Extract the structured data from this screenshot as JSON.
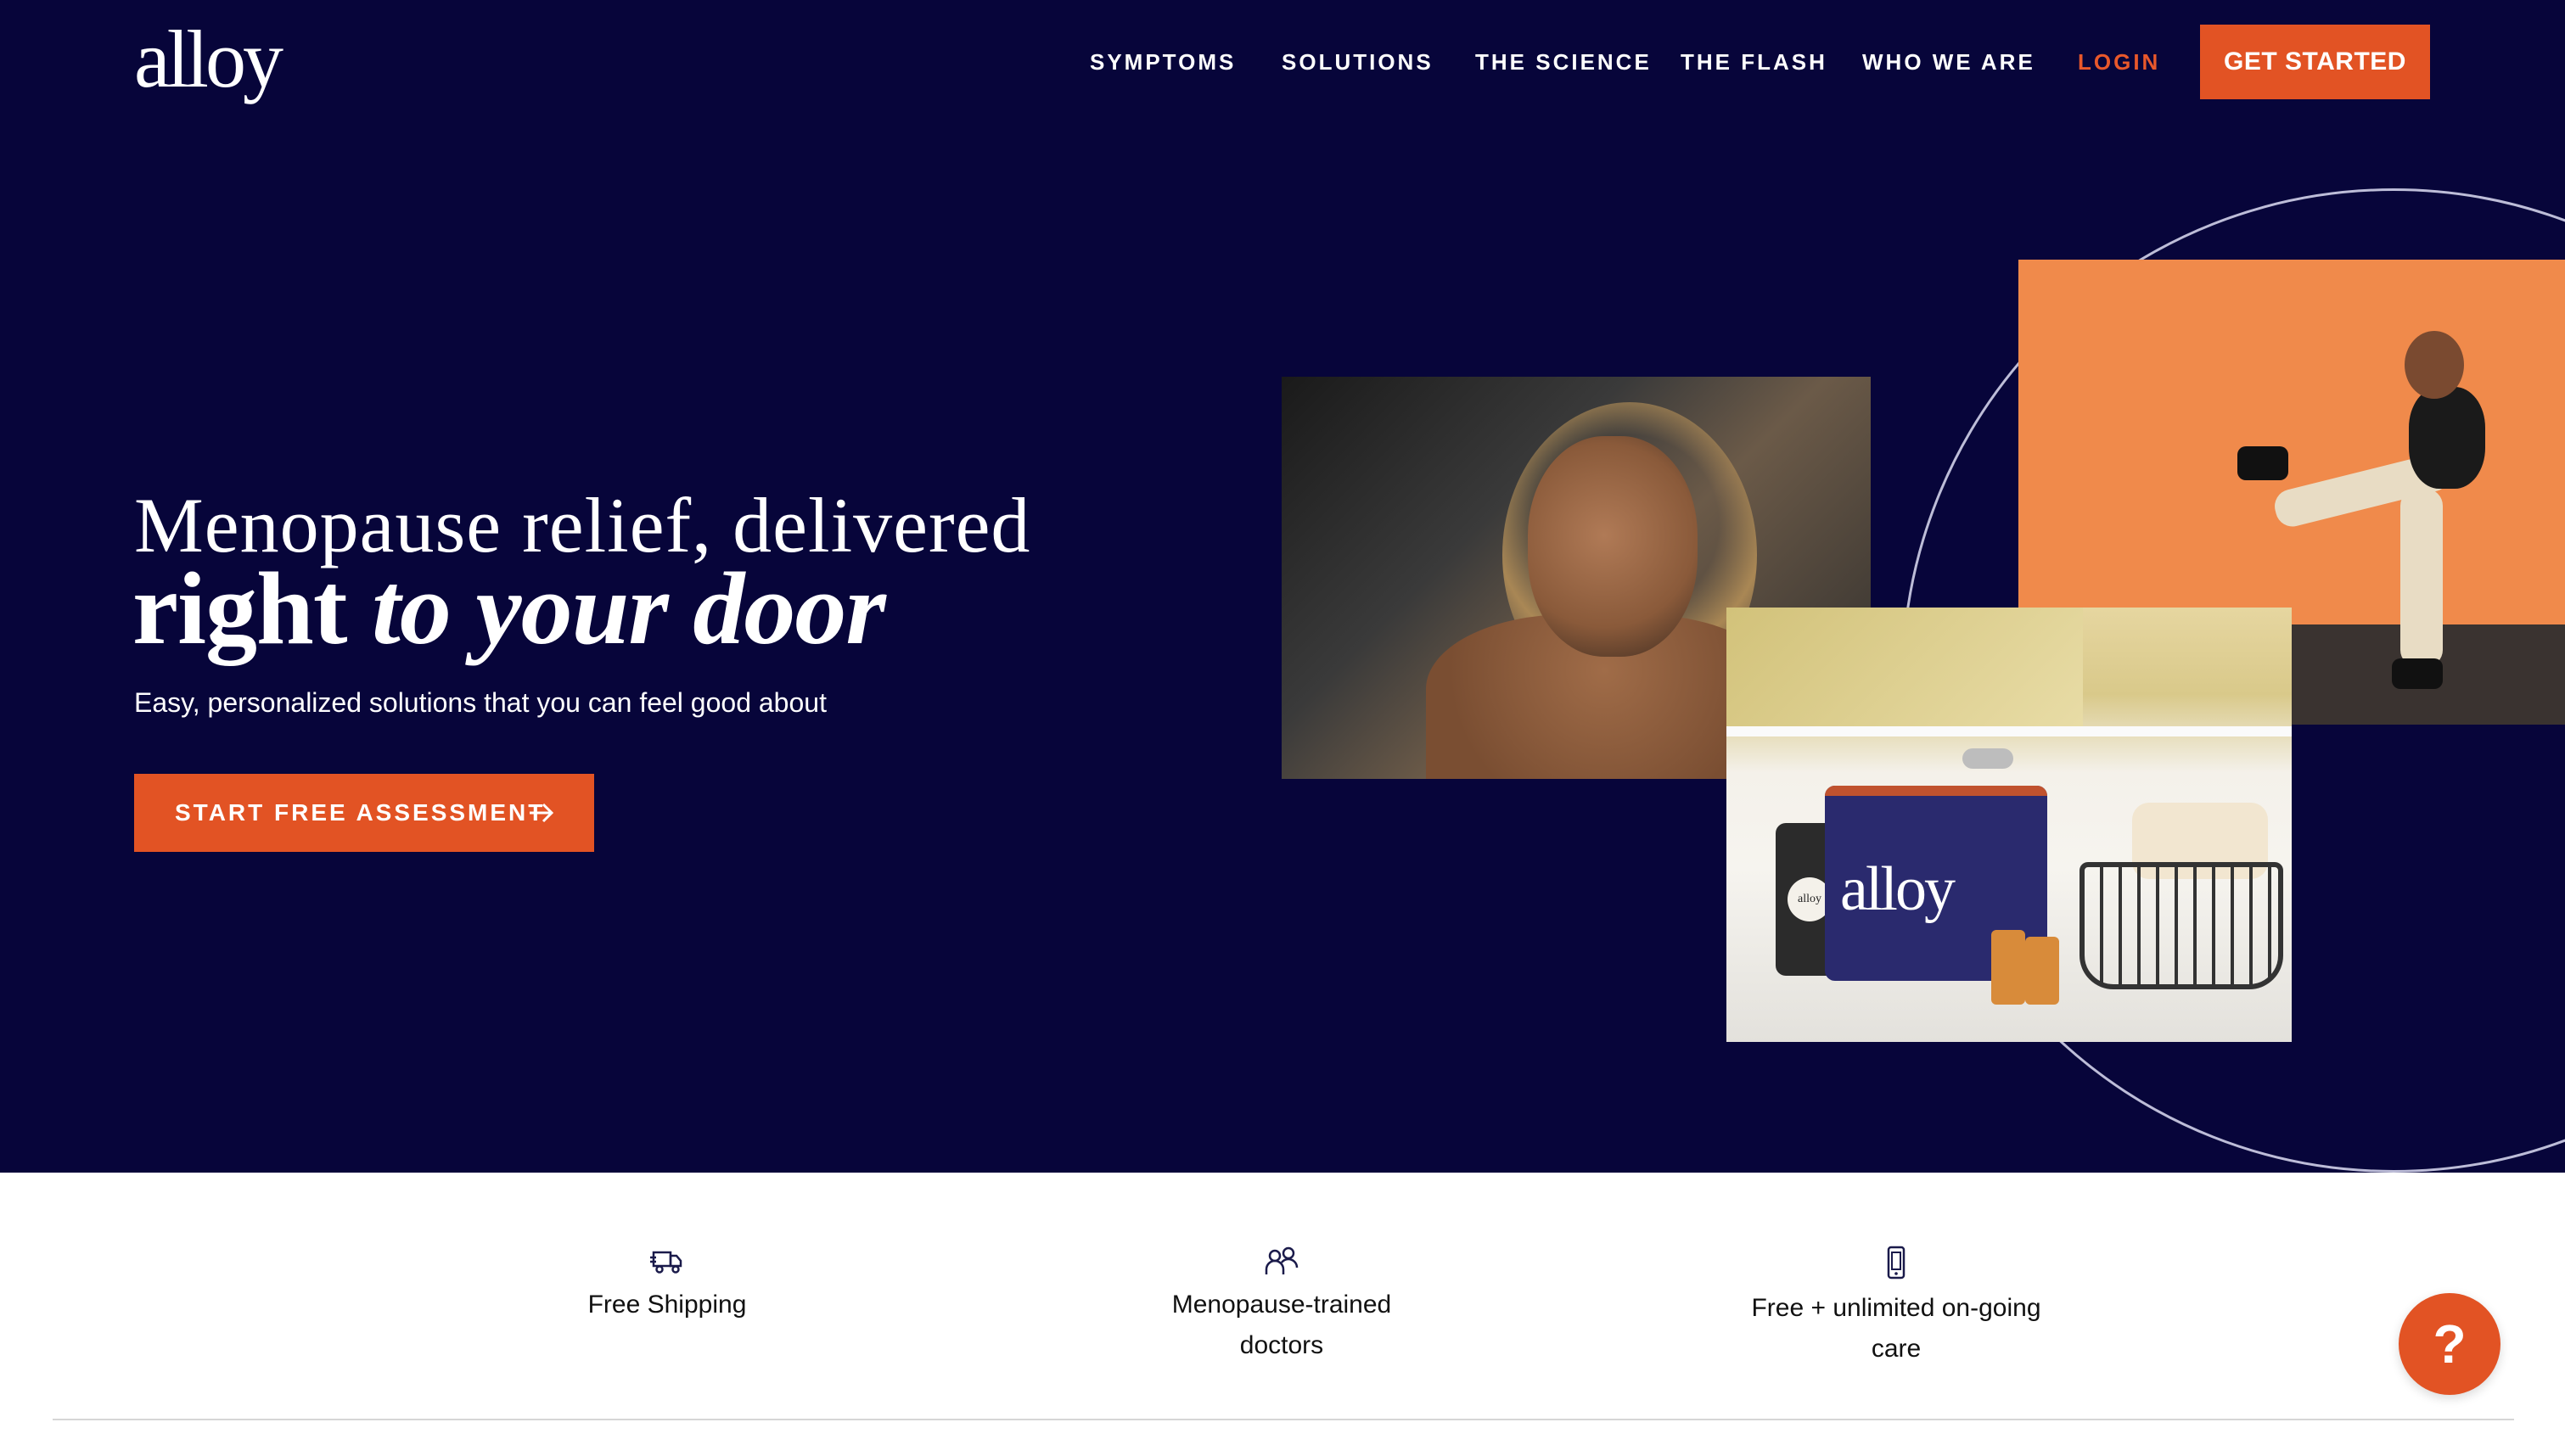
{
  "brand": {
    "logo_text": "alloy",
    "accent_color": "#e25324",
    "hero_bg": "#07053a"
  },
  "nav": {
    "items": [
      {
        "label": "SYMPTOMS"
      },
      {
        "label": "SOLUTIONS"
      },
      {
        "label": "THE SCIENCE"
      },
      {
        "label": "THE FLASH"
      },
      {
        "label": "WHO WE ARE"
      }
    ],
    "login_label": "LOGIN",
    "cta_label": "GET STARTED"
  },
  "hero": {
    "headline_line1": "Menopause relief, delivered",
    "headline_line2_bold": "right ",
    "headline_line2_italic": "to your door",
    "subtext": "Easy, personalized solutions that you can feel good about",
    "cta_label": "START FREE ASSESSMENT",
    "cta_icon": "arrow-right-icon",
    "kit_bag_text": "alloy",
    "kit_jar_text": "alloy"
  },
  "features": [
    {
      "icon": "truck-icon",
      "line1": "Free Shipping",
      "line2": ""
    },
    {
      "icon": "doctors-icon",
      "line1": "Menopause-trained",
      "line2": "doctors"
    },
    {
      "icon": "phone-icon",
      "line1": "Free + unlimited on-going",
      "line2": "care"
    }
  ],
  "help_button": {
    "label": "?"
  }
}
